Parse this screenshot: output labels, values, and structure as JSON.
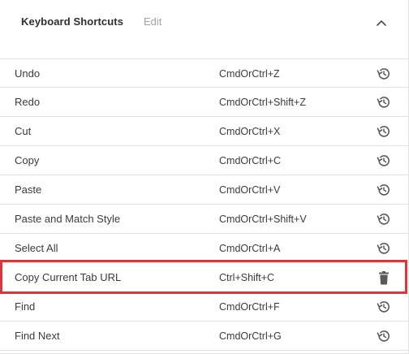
{
  "header": {
    "title": "Keyboard Shortcuts",
    "edit_label": "Edit",
    "collapse_icon": "chevron-up-icon"
  },
  "shortcuts": [
    {
      "label": "Undo",
      "shortcut": "CmdOrCtrl+Z",
      "action_icon": "reset-icon"
    },
    {
      "label": "Redo",
      "shortcut": "CmdOrCtrl+Shift+Z",
      "action_icon": "reset-icon"
    },
    {
      "label": "Cut",
      "shortcut": "CmdOrCtrl+X",
      "action_icon": "reset-icon"
    },
    {
      "label": "Copy",
      "shortcut": "CmdOrCtrl+C",
      "action_icon": "reset-icon"
    },
    {
      "label": "Paste",
      "shortcut": "CmdOrCtrl+V",
      "action_icon": "reset-icon"
    },
    {
      "label": "Paste and Match Style",
      "shortcut": "CmdOrCtrl+Shift+V",
      "action_icon": "reset-icon"
    },
    {
      "label": "Select All",
      "shortcut": "CmdOrCtrl+A",
      "action_icon": "reset-icon"
    },
    {
      "label": "Copy Current Tab URL",
      "shortcut": "Ctrl+Shift+C",
      "action_icon": "trash-icon"
    },
    {
      "label": "Find",
      "shortcut": "CmdOrCtrl+F",
      "action_icon": "reset-icon"
    },
    {
      "label": "Find Next",
      "shortcut": "CmdOrCtrl+G",
      "action_icon": "reset-icon"
    }
  ],
  "colors": {
    "highlight": "#d9363e",
    "icon": "#5a5a5a",
    "divider": "#e3e3e3"
  }
}
